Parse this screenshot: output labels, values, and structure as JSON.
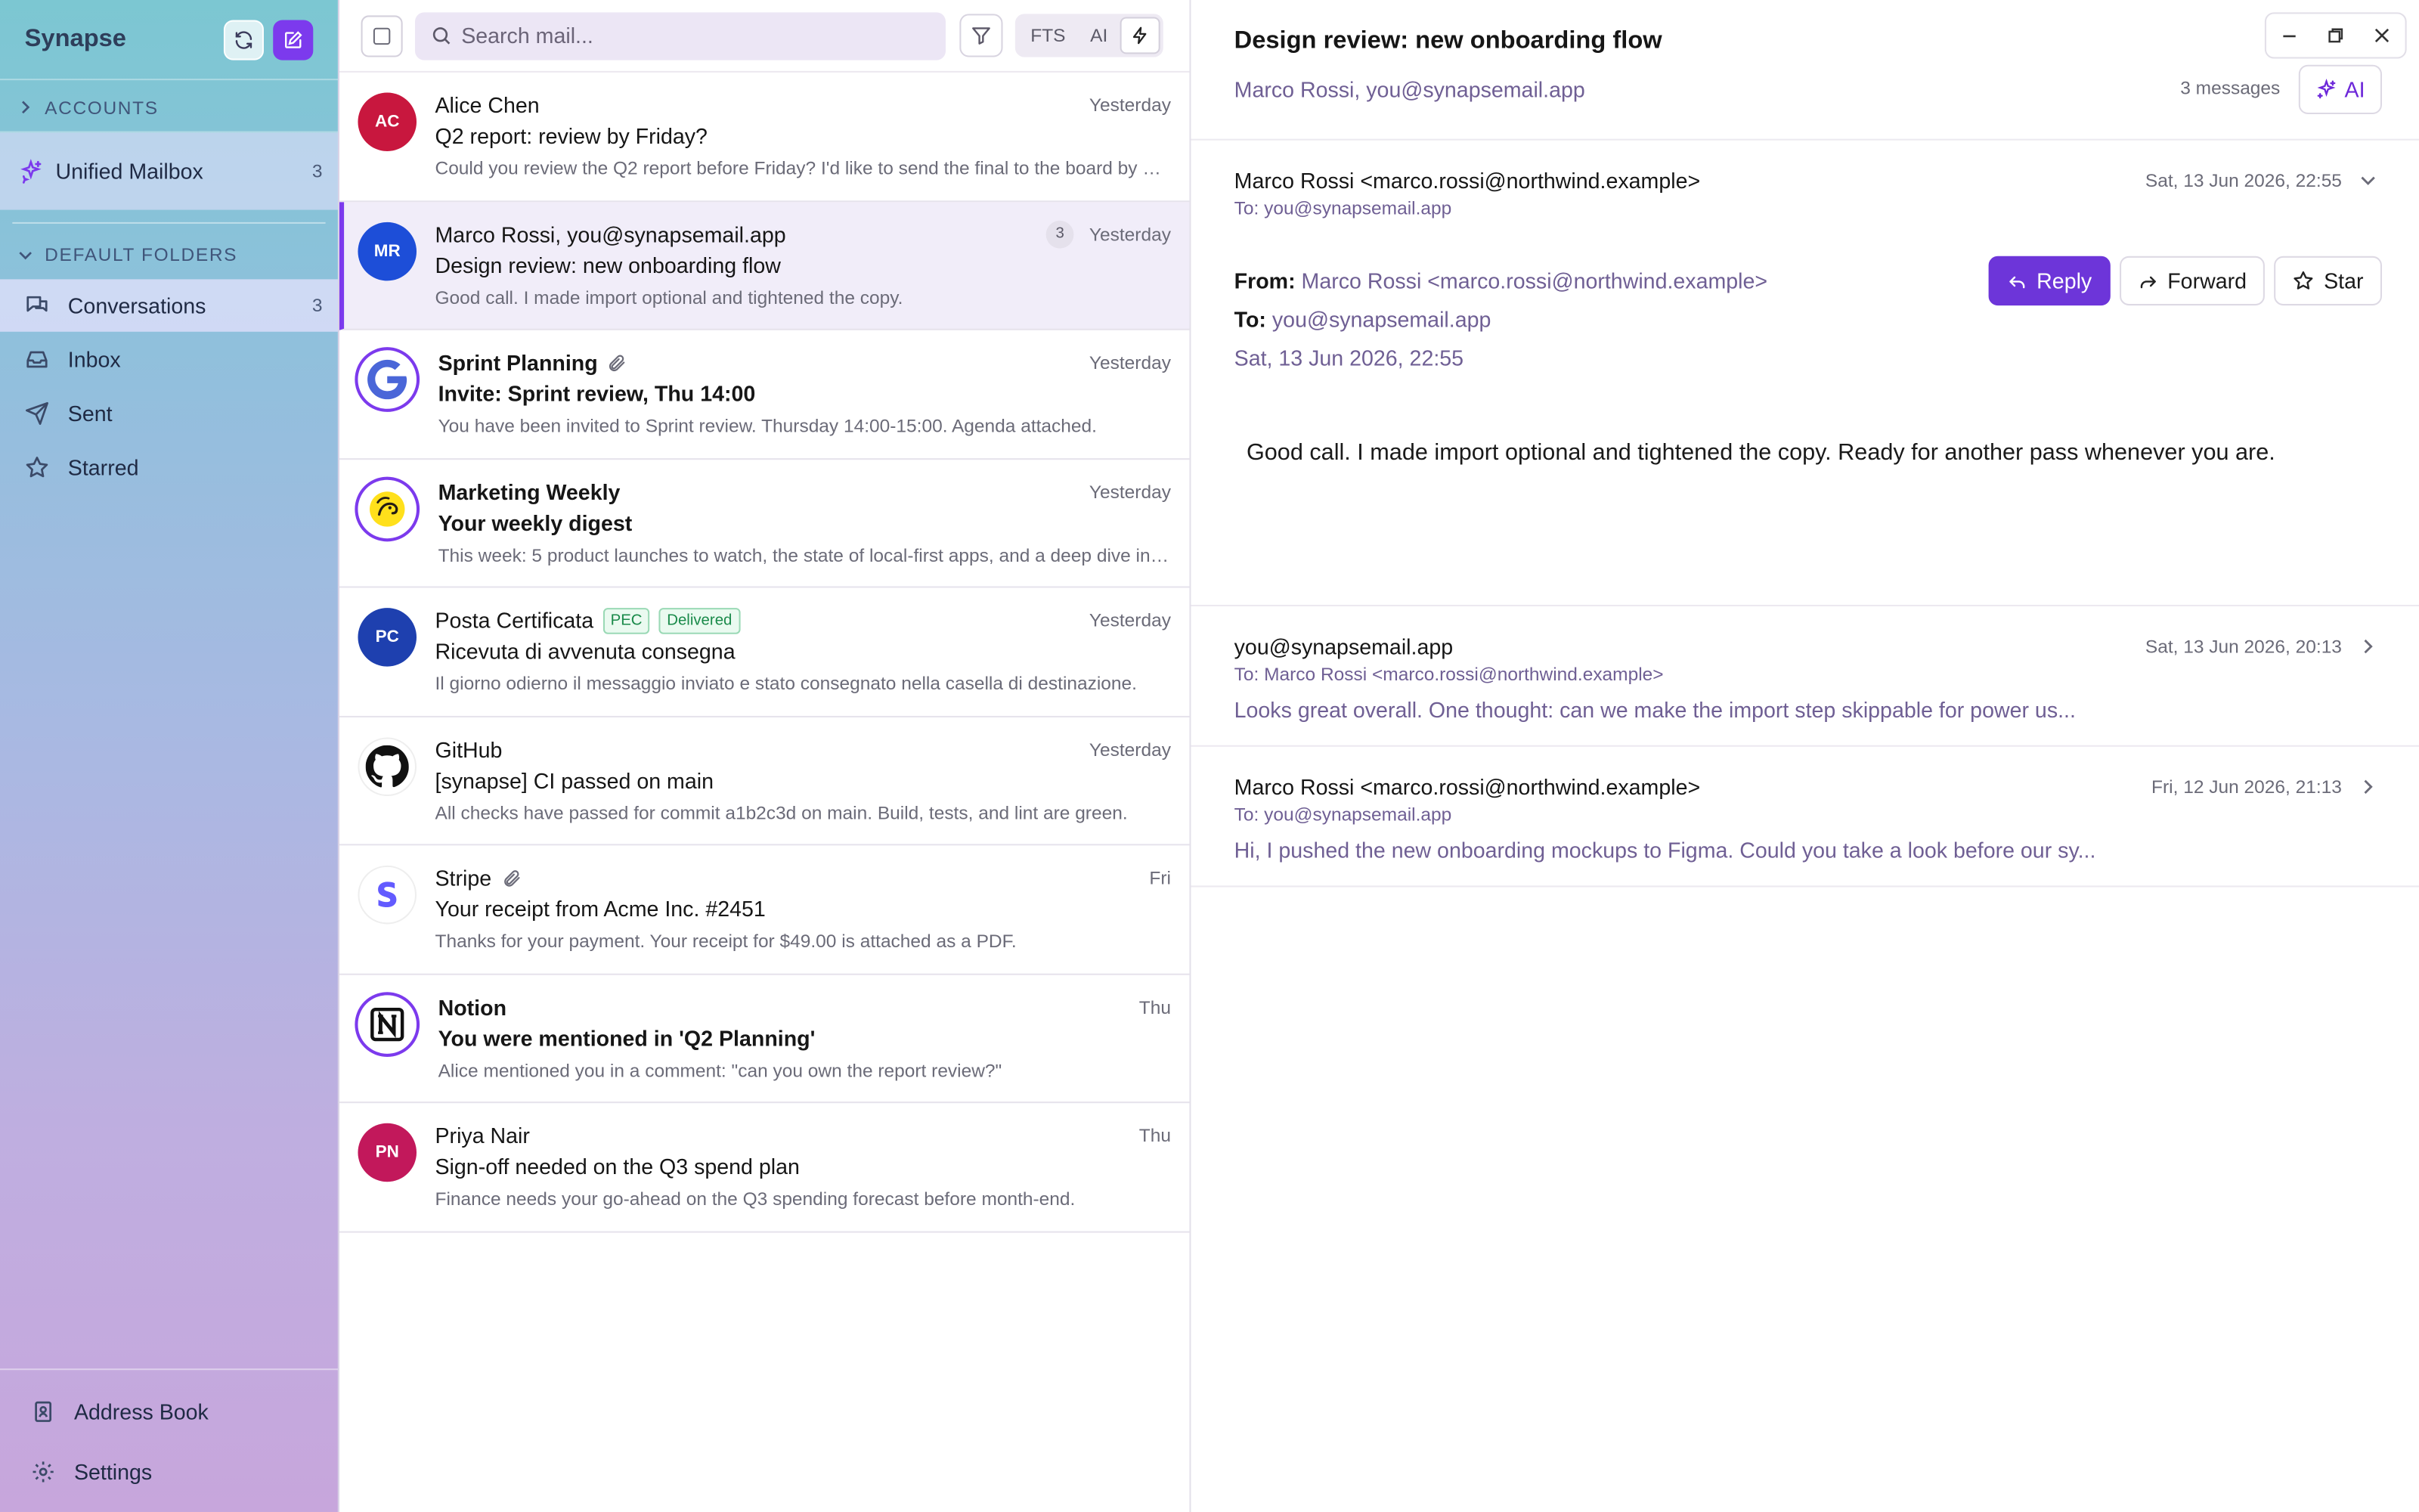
{
  "app": {
    "name": "Synapse"
  },
  "sidebar": {
    "accounts_label": "ACCOUNTS",
    "unified": {
      "label": "Unified Mailbox",
      "count": "3"
    },
    "folders_label": "DEFAULT FOLDERS",
    "folders": [
      {
        "label": "Conversations",
        "count": "3",
        "icon": "conversations-icon"
      },
      {
        "label": "Inbox",
        "count": "",
        "icon": "inbox-icon"
      },
      {
        "label": "Sent",
        "count": "",
        "icon": "send-icon"
      },
      {
        "label": "Starred",
        "count": "",
        "icon": "star-icon"
      }
    ],
    "bottom": [
      {
        "label": "Address Book",
        "icon": "address-book-icon"
      },
      {
        "label": "Settings",
        "icon": "gear-icon"
      }
    ]
  },
  "list": {
    "search_placeholder": "Search mail...",
    "modes": [
      "FTS",
      "AI"
    ],
    "messages": [
      {
        "sender": "Alice Chen",
        "initials": "AC",
        "avatar_color": "#c8173e",
        "date": "Yesterday",
        "subject": "Q2 report: review by Friday?",
        "preview": "Could you review the Q2 report before Friday? I'd like to send the final to the board by Monday."
      },
      {
        "sender": "Marco Rossi, you@synapsemail.app",
        "initials": "MR",
        "avatar_color": "#1d4ed8",
        "date": "Yesterday",
        "thread_count": "3",
        "subject": "Design review: new onboarding flow",
        "preview": "Good call. I made import optional and tightened the copy."
      },
      {
        "sender": "Sprint Planning",
        "date": "Yesterday",
        "subject": "Invite: Sprint review, Thu 14:00",
        "preview": "You have been invited to Sprint review. Thursday 14:00-15:00. Agenda attached."
      },
      {
        "sender": "Marketing Weekly",
        "date": "Yesterday",
        "subject": "Your weekly digest",
        "preview": "This week: 5 product launches to watch, the state of local-first apps, and a deep dive into sync engines."
      },
      {
        "sender": "Posta Certificata",
        "initials": "PC",
        "avatar_color": "#1e40af",
        "date": "Yesterday",
        "badge_pec": "PEC",
        "badge_status": "Delivered",
        "subject": "Ricevuta di avvenuta consegna",
        "preview": "Il giorno odierno il messaggio inviato e stato consegnato nella casella di destinazione."
      },
      {
        "sender": "GitHub",
        "date": "Yesterday",
        "subject": "[synapse] CI passed on main",
        "preview": "All checks have passed for commit a1b2c3d on main. Build, tests, and lint are green."
      },
      {
        "sender": "Stripe",
        "date": "Fri",
        "subject": "Your receipt from Acme Inc. #2451",
        "preview": "Thanks for your payment. Your receipt for $49.00 is attached as a PDF."
      },
      {
        "sender": "Notion",
        "date": "Thu",
        "subject": "You were mentioned in 'Q2 Planning'",
        "preview": "Alice mentioned you in a comment: \"can you own the report review?\""
      },
      {
        "sender": "Priya Nair",
        "initials": "PN",
        "avatar_color": "#c2185b",
        "date": "Thu",
        "subject": "Sign-off needed on the Q3 spend plan",
        "preview": "Finance needs your go-ahead on the Q3 spending forecast before month-end."
      }
    ]
  },
  "reader": {
    "title": "Design review: new onboarding flow",
    "participants": "Marco Rossi, you@synapsemail.app",
    "message_count": "3 messages",
    "ai_label": "AI",
    "open": {
      "from": "Marco Rossi <marco.rossi@northwind.example>",
      "to": "To: you@synapsemail.app",
      "date": "Sat, 13 Jun 2026, 22:55",
      "from_label": "From:",
      "from_value": "Marco Rossi <marco.rossi@northwind.example>",
      "to_label": "To:",
      "to_value": "you@synapsemail.app",
      "date_line": "Sat, 13 Jun 2026, 22:55",
      "body": "Good call. I made import optional and tightened the copy. Ready for another pass whenever you are.",
      "reply": "Reply",
      "forward": "Forward",
      "star": "Star"
    },
    "collapsed": [
      {
        "from": "you@synapsemail.app",
        "to": "To: Marco Rossi <marco.rossi@northwind.example>",
        "date": "Sat, 13 Jun 2026, 20:13",
        "preview": "Looks great overall. One thought: can we make the import step skippable for power us..."
      },
      {
        "from": "Marco Rossi <marco.rossi@northwind.example>",
        "to": "To: you@synapsemail.app",
        "date": "Fri, 12 Jun 2026, 21:13",
        "preview": "Hi, I pushed the new onboarding mockups to Figma. Could you take a look before our sy..."
      }
    ]
  }
}
